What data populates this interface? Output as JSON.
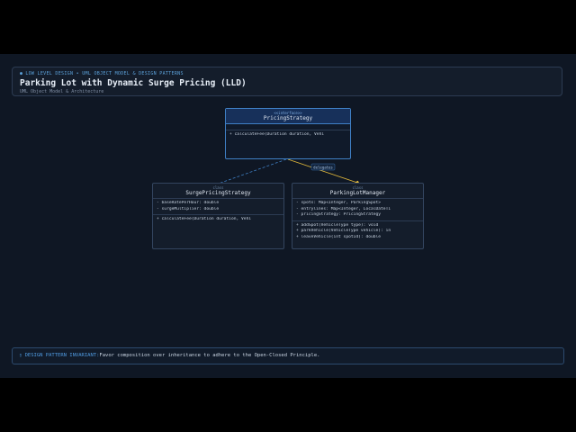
{
  "header": {
    "breadcrumb": "LOW LEVEL DESIGN • UML OBJECT MODEL & DESIGN PATTERNS",
    "title": "Parking Lot with Dynamic Surge Pricing (LLD)",
    "subtitle": "UML Object Model & Architecture"
  },
  "classes": {
    "pricing_strategy": {
      "stereotype": "<<interface>>",
      "name": "PricingStrategy",
      "methods": [
        "+ calculateFee(Duration duration, Vehi"
      ]
    },
    "surge_pricing_strategy": {
      "stereotype": "class",
      "name": "SurgePricingStrategy",
      "attributes": [
        "- baseRatePerHour: double",
        "- surgeMultiplier: double"
      ],
      "methods": [
        "+ calculateFee(Duration duration, Vehi"
      ]
    },
    "parking_lot_manager": {
      "stereotype": "class",
      "name": "ParkingLotManager",
      "attributes": [
        "- spots: Map<Integer, ParkingSpot>",
        "- entrylines: Map<Integer, LocalDateTi",
        "- pricingStrategy: PricingStrategy"
      ],
      "methods": [
        "+ addSpot(VehicleType type): void",
        "+ parkVehicle(VehicleType vehicle): in",
        "+ leaveVehicle(int spotId): double"
      ]
    }
  },
  "relations": {
    "delegates_label": "delegates"
  },
  "footer": {
    "label": "▯ DESIGN PATTERN INVARIANT:",
    "text": "Favor composition over inheritance to adhere to the Open-Closed Principle."
  },
  "colors": {
    "interface_border": "#3f7fc4",
    "delegate_line": "#e2b93b",
    "realization_line": "#3f7fc4"
  }
}
